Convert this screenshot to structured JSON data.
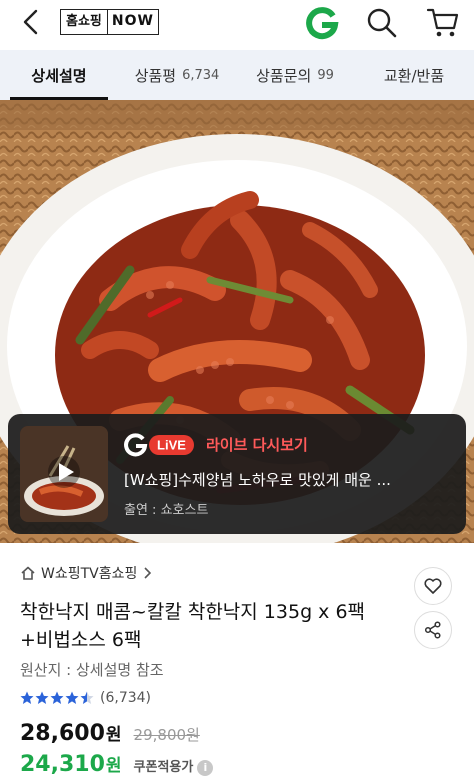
{
  "header": {
    "logo_part1": "홈쇼핑",
    "logo_part2": "NOW",
    "back_icon": "chevron-left-icon",
    "g_icon": "g-logo-icon",
    "search_icon": "search-icon",
    "cart_icon": "cart-icon"
  },
  "tabs": [
    {
      "label": "상세설명",
      "count": "",
      "active": true
    },
    {
      "label": "상품평",
      "count": "6,734",
      "active": false
    },
    {
      "label": "상품문의",
      "count": "99",
      "active": false
    },
    {
      "label": "교환/반품",
      "count": "",
      "active": false
    }
  ],
  "live": {
    "logo_text": "LiVE",
    "badge_title": "라이브 다시보기",
    "title": "[W쇼핑]수제양념 노하우로 맛있게 매운 ...",
    "host": "출연 : 쇼호스트"
  },
  "product": {
    "seller": "W쇼핑TV홈쇼핑",
    "title": "착한낙지 매콤~칼칼 착한낙지 135g x 6팩+비법소스 6팩",
    "origin": "원산지 : 상세설명 참조",
    "rating": 4.5,
    "review_count": "(6,734)",
    "price": "28,600",
    "price_unit": "원",
    "original_price": "29,800원",
    "coupon_price": "24,310",
    "coupon_unit": "원",
    "coupon_label": "쿠폰적용가",
    "info_mark": "i"
  },
  "colors": {
    "accent_green": "#1ca84a",
    "live_red": "#ff5a5a",
    "star": "#2b63d9",
    "tab_bg": "#eef2f8"
  }
}
